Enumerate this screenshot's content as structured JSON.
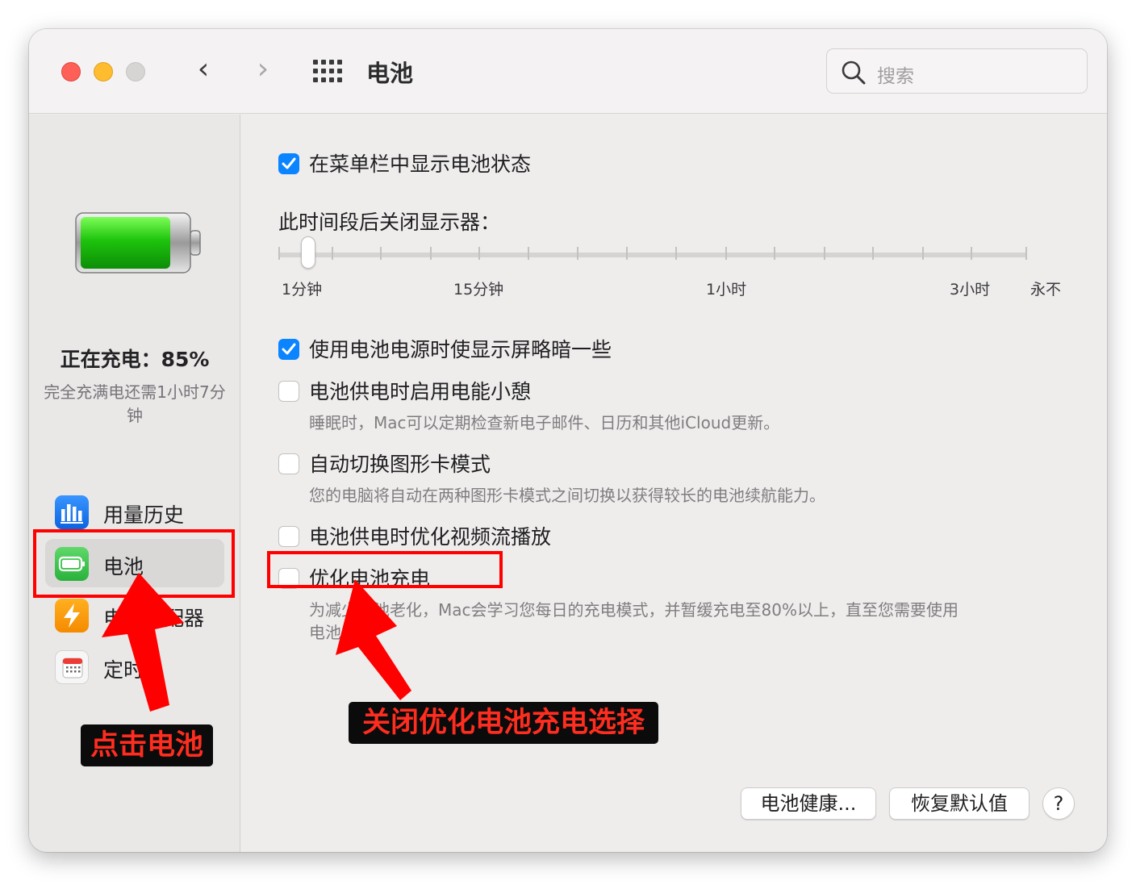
{
  "window": {
    "title": "电池",
    "search_placeholder": "搜索",
    "nav_back": "‹",
    "nav_forward": "›"
  },
  "sidebar": {
    "status_title": "正在充电：85%",
    "status_sub": "完全充满电还需1小时7分钟",
    "battery_level": 0.85,
    "items": [
      {
        "label": "用量历史",
        "icon": "bar-chart-icon"
      },
      {
        "label": "电池",
        "icon": "battery-icon",
        "selected": true
      },
      {
        "label": "电源适配器",
        "icon": "lightning-icon"
      },
      {
        "label": "定时",
        "icon": "calendar-icon"
      }
    ]
  },
  "content": {
    "show_status": {
      "label": "在菜单栏中显示电池状态",
      "checked": true
    },
    "display_off_label": "此时间段后关闭显示器：",
    "slider": {
      "value": "1分钟",
      "ticks": [
        "1分钟",
        "15分钟",
        "1小时",
        "3小时",
        "永不"
      ]
    },
    "dim_display": {
      "label": "使用电池电源时使显示屏略暗一些",
      "checked": true
    },
    "power_nap": {
      "label": "电池供电时启用电能小憩",
      "checked": false,
      "desc": "睡眠时，Mac可以定期检查新电子邮件、日历和其他iCloud更新。"
    },
    "graphics_switch": {
      "label": "自动切换图形卡模式",
      "checked": false,
      "desc": "您的电脑将自动在两种图形卡模式之间切换以获得较长的电池续航能力。"
    },
    "video_stream": {
      "label": "电池供电时优化视频流播放",
      "checked": false
    },
    "optimized_charging": {
      "label": "优化电池充电",
      "checked": false,
      "desc_line1": "为减少电池老化，Mac会学习您每日的充电模式，并暂缓充电至80%以上，直至您需要使用",
      "desc_line2": "电池。"
    },
    "buttons": {
      "battery_health": "电池健康...",
      "restore_defaults": "恢复默认值",
      "help": "?"
    }
  },
  "annotations": {
    "left_label": "点击电池",
    "right_label": "关闭优化电池充电选择",
    "color": "#ff0000"
  }
}
